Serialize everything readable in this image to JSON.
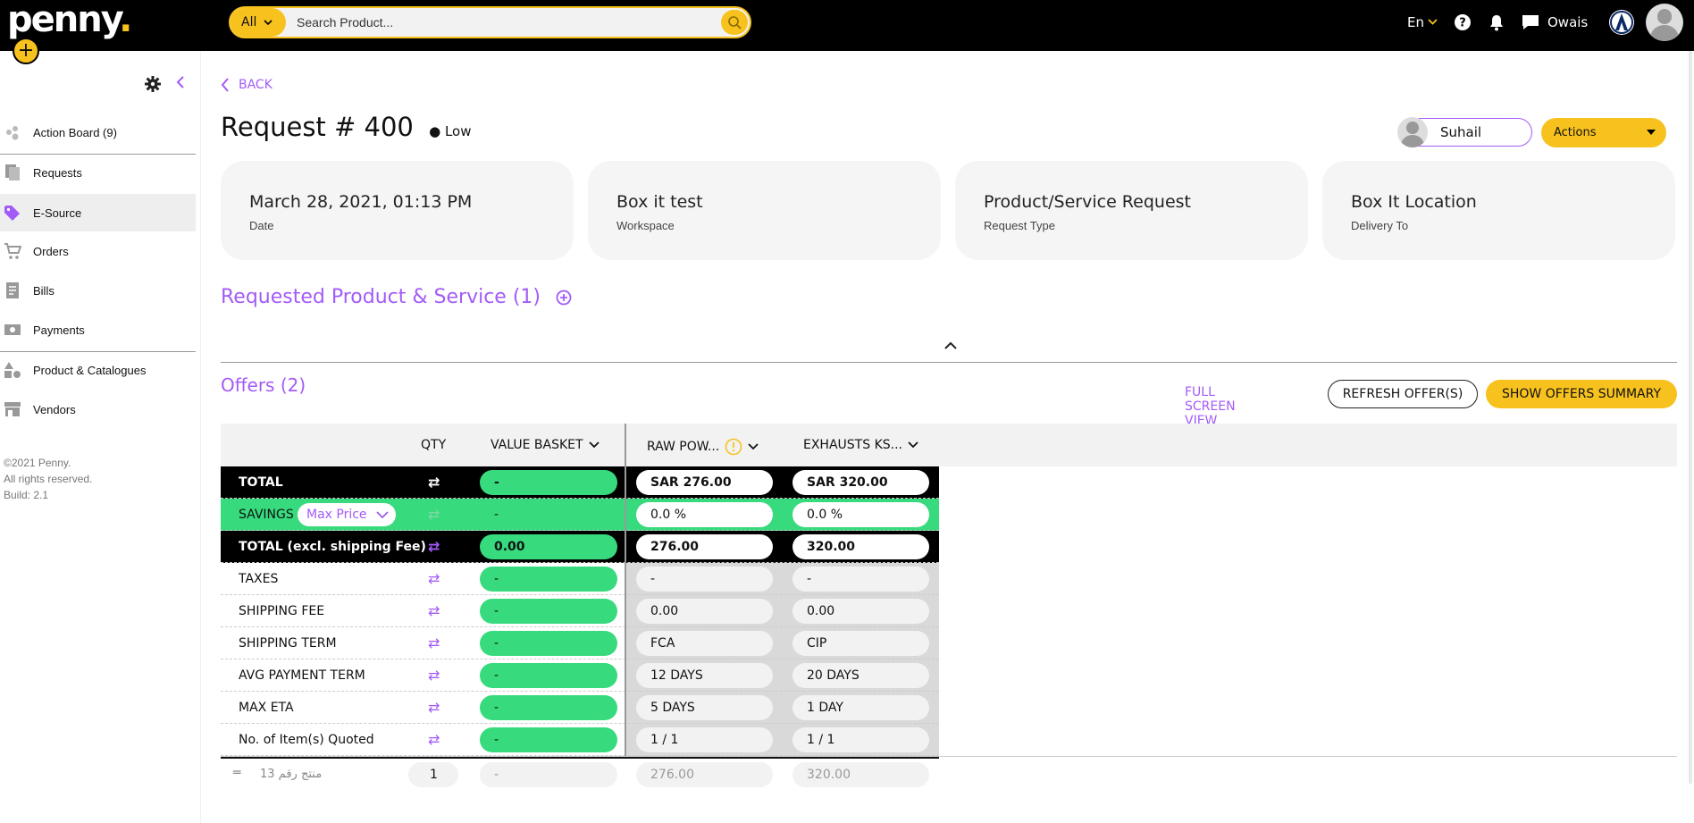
{
  "app": {
    "logo": "penny",
    "logo_dot": "."
  },
  "search": {
    "scope": "All",
    "placeholder": "Search Product..."
  },
  "topbar": {
    "language": "En",
    "company": "Owais"
  },
  "sidebar": {
    "items": [
      {
        "label": "Action Board (9)"
      },
      {
        "label": "Requests"
      },
      {
        "label": "E-Source"
      },
      {
        "label": "Orders"
      },
      {
        "label": "Bills"
      },
      {
        "label": "Payments"
      },
      {
        "label": "Product & Catalogues"
      },
      {
        "label": "Vendors"
      }
    ],
    "footer": [
      "©2021 Penny.",
      "All rights reserved.",
      "Build: 2.1"
    ]
  },
  "page": {
    "back": "BACK",
    "title": "Request # 400",
    "priority": "Low",
    "assignee": "Suhail",
    "actions": "Actions"
  },
  "cards": [
    {
      "value": "March 28, 2021, 01:13 PM",
      "label": "Date"
    },
    {
      "value": "Box it test",
      "label": "Workspace"
    },
    {
      "value": "Product/Service Request",
      "label": "Request Type"
    },
    {
      "value": "Box It Location",
      "label": "Delivery To"
    }
  ],
  "requested": {
    "title": "Requested Product & Service (1)"
  },
  "offers": {
    "title": "Offers (2)",
    "full_screen": "FULL SCREEN VIEW",
    "refresh": "REFRESH OFFER(S)",
    "summary": "SHOW OFFERS SUMMARY",
    "columns": {
      "qty": "QTY",
      "basket": "VALUE BASKET",
      "offer1": "RAW POW...",
      "offer2": "EXHAUSTS KS..."
    },
    "savings_select": "Max Price",
    "rows": [
      {
        "label": "TOTAL",
        "basket": "-",
        "o1": "SAR 276.00",
        "o2": "SAR 320.00"
      },
      {
        "label": "SAVINGS",
        "basket": "-",
        "o1": "0.0 %",
        "o2": "0.0 %"
      },
      {
        "label": "TOTAL (excl. shipping Fee)",
        "basket": "0.00",
        "o1": "276.00",
        "o2": "320.00"
      },
      {
        "label": "TAXES",
        "basket": "-",
        "o1": "-",
        "o2": "-"
      },
      {
        "label": "SHIPPING FEE",
        "basket": "-",
        "o1": "0.00",
        "o2": "0.00"
      },
      {
        "label": "SHIPPING TERM",
        "basket": "-",
        "o1": "FCA",
        "o2": "CIP"
      },
      {
        "label": "AVG PAYMENT TERM",
        "basket": "-",
        "o1": "12 DAYS",
        "o2": "20 DAYS"
      },
      {
        "label": "MAX ETA",
        "basket": "-",
        "o1": "5 DAYS",
        "o2": "1 DAY"
      },
      {
        "label": "No. of Item(s) Quoted",
        "basket": "-",
        "o1": "1 / 1",
        "o2": "1 / 1"
      }
    ],
    "item_row": {
      "name": "منتج رقم 13",
      "qty": "1",
      "basket": "-",
      "o1": "276.00",
      "o2": "320.00"
    }
  }
}
